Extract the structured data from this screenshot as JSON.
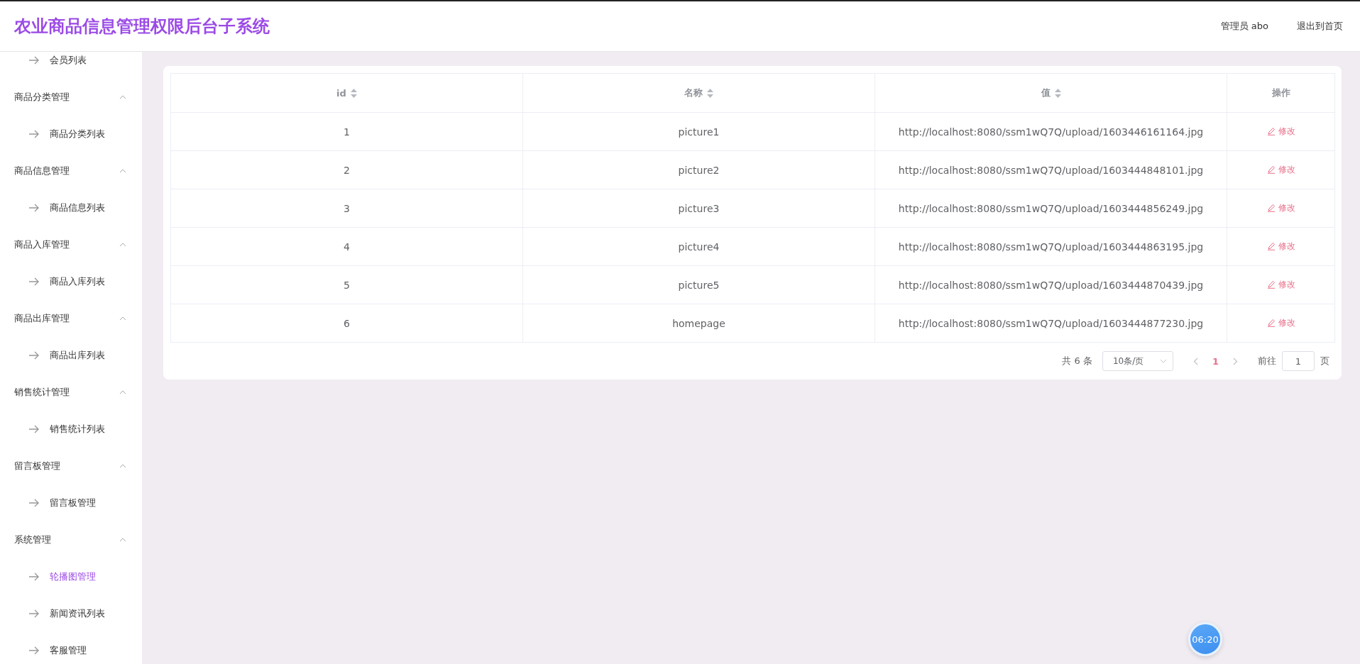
{
  "header": {
    "title": "农业商品信息管理权限后台子系统",
    "user": "管理员 abo",
    "logout": "退出到首页"
  },
  "sidebar": {
    "items": [
      {
        "kind": "link",
        "label": "会员列表",
        "selected": false
      },
      {
        "kind": "group",
        "label": "商品分类管理",
        "expanded": true,
        "children": [
          {
            "label": "商品分类列表",
            "selected": false
          }
        ]
      },
      {
        "kind": "group",
        "label": "商品信息管理",
        "expanded": true,
        "children": [
          {
            "label": "商品信息列表",
            "selected": false
          }
        ]
      },
      {
        "kind": "group",
        "label": "商品入库管理",
        "expanded": true,
        "children": [
          {
            "label": "商品入库列表",
            "selected": false
          }
        ]
      },
      {
        "kind": "group",
        "label": "商品出库管理",
        "expanded": true,
        "children": [
          {
            "label": "商品出库列表",
            "selected": false
          }
        ]
      },
      {
        "kind": "group",
        "label": "销售统计管理",
        "expanded": true,
        "children": [
          {
            "label": "销售统计列表",
            "selected": false
          }
        ]
      },
      {
        "kind": "group",
        "label": "留言板管理",
        "expanded": true,
        "children": [
          {
            "label": "留言板管理",
            "selected": false
          }
        ]
      },
      {
        "kind": "group",
        "label": "系统管理",
        "expanded": true,
        "children": [
          {
            "label": "轮播图管理",
            "selected": true
          },
          {
            "label": "新闻资讯列表",
            "selected": false
          },
          {
            "label": "客服管理",
            "selected": false
          }
        ]
      }
    ]
  },
  "table": {
    "columns": [
      {
        "label": "id",
        "sortable": true
      },
      {
        "label": "名称",
        "sortable": true
      },
      {
        "label": "值",
        "sortable": true
      },
      {
        "label": "操作",
        "sortable": false
      }
    ],
    "rows": [
      {
        "cells": [
          "1",
          "picture1",
          "http://localhost:8080/ssm1wQ7Q/upload/1603446161164.jpg"
        ],
        "action": "修改"
      },
      {
        "cells": [
          "2",
          "picture2",
          "http://localhost:8080/ssm1wQ7Q/upload/1603444848101.jpg"
        ],
        "action": "修改"
      },
      {
        "cells": [
          "3",
          "picture3",
          "http://localhost:8080/ssm1wQ7Q/upload/1603444856249.jpg"
        ],
        "action": "修改"
      },
      {
        "cells": [
          "4",
          "picture4",
          "http://localhost:8080/ssm1wQ7Q/upload/1603444863195.jpg"
        ],
        "action": "修改"
      },
      {
        "cells": [
          "5",
          "picture5",
          "http://localhost:8080/ssm1wQ7Q/upload/1603444870439.jpg"
        ],
        "action": "修改"
      },
      {
        "cells": [
          "6",
          "homepage",
          "http://localhost:8080/ssm1wQ7Q/upload/1603444877230.jpg"
        ],
        "action": "修改"
      }
    ]
  },
  "pagination": {
    "total": "共 6 条",
    "page_size": "10条/页",
    "pages": [
      {
        "label": "1",
        "selected": true
      }
    ],
    "goto_label": "前往",
    "goto_value": "1",
    "goto_suffix": "页"
  },
  "clock": {
    "time": "06:20"
  }
}
